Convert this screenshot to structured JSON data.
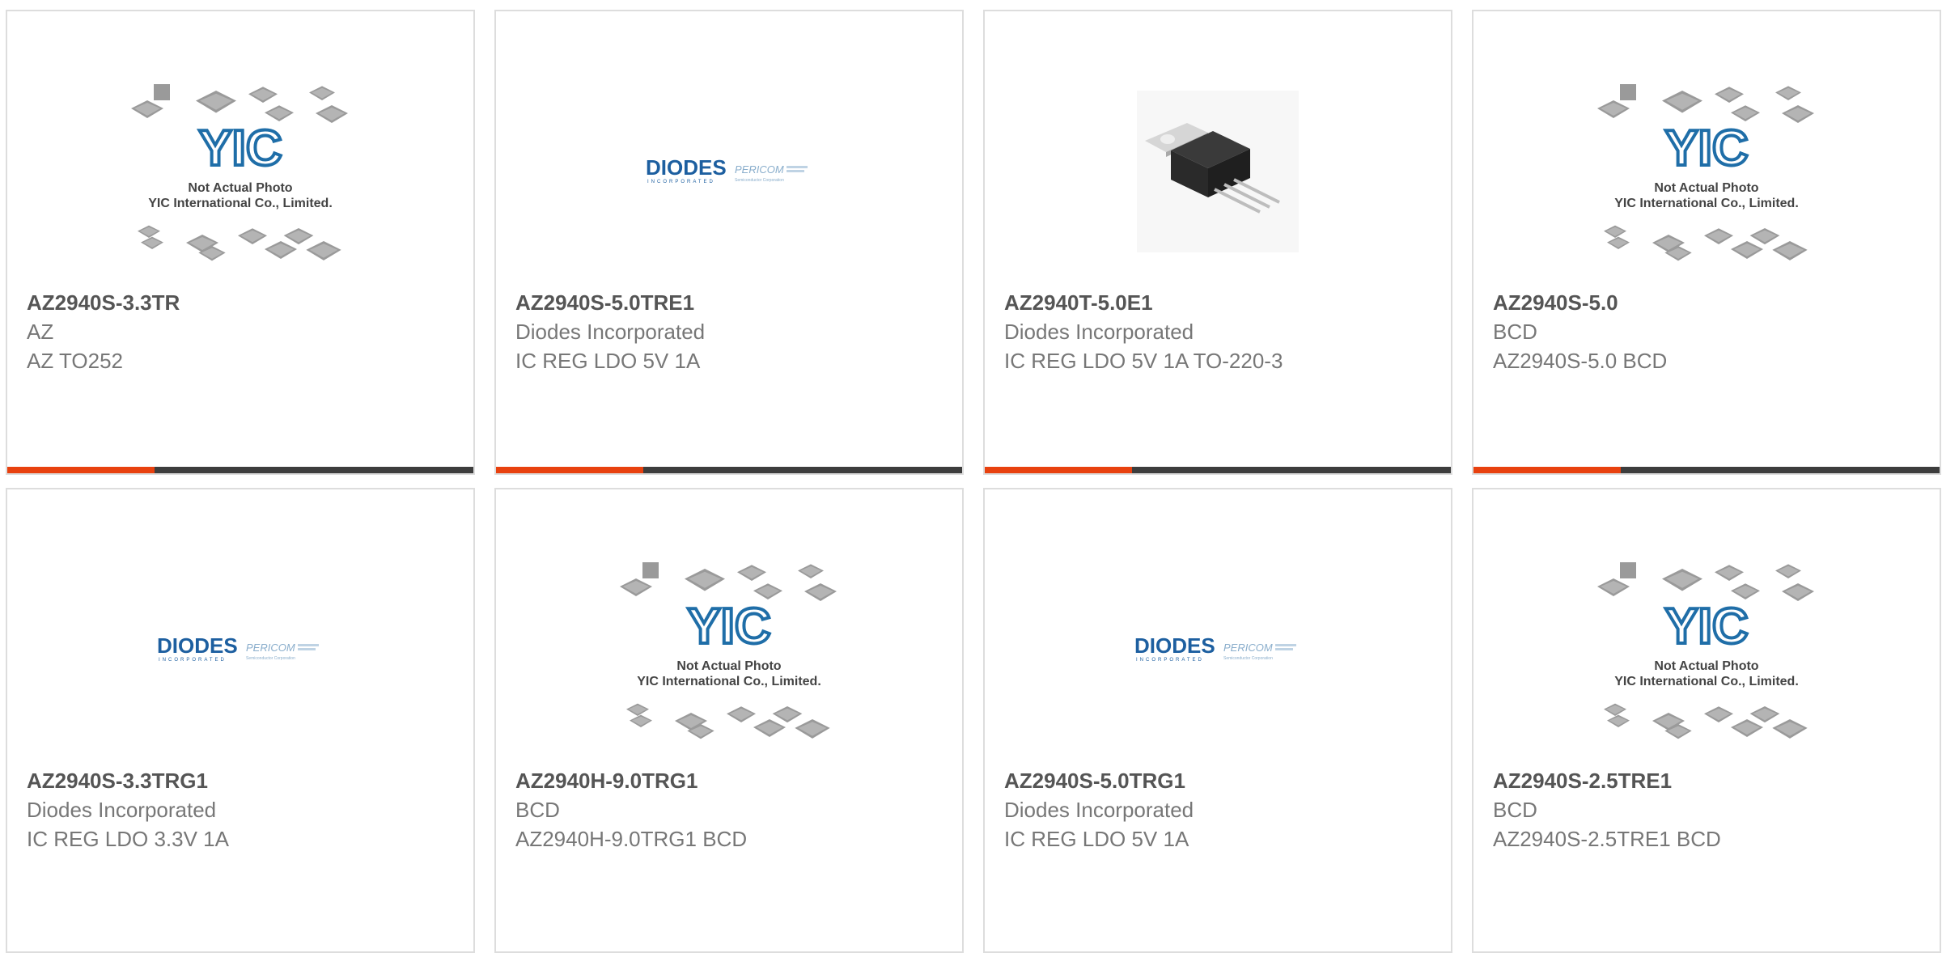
{
  "colors": {
    "accent_bar": "#e8410f",
    "dark_bar": "#3d3d3d",
    "border": "#dddddd",
    "yic_blue": "#1f6ea8",
    "diodes_blue": "#1d5fa0"
  },
  "placeholder_logo": {
    "brand": "YIC",
    "line1": "Not Actual Photo",
    "line2": "YIC International Co., Limited."
  },
  "diodes_logo": {
    "brand": "DIODES",
    "tagline": "INCORPORATED",
    "partner": "PERICOM",
    "partner_tagline": "Semiconductor Corporation"
  },
  "products": [
    {
      "part": "AZ2940S-3.3TR",
      "manufacturer": "AZ",
      "description": "AZ TO252",
      "image": "not-actual-photo"
    },
    {
      "part": "AZ2940S-5.0TRE1",
      "manufacturer": "Diodes Incorporated",
      "description": "IC REG LDO 5V 1A",
      "image": "diodes-logo"
    },
    {
      "part": "AZ2940T-5.0E1",
      "manufacturer": "Diodes Incorporated",
      "description": "IC REG LDO 5V 1A TO-220-3",
      "image": "to220-package"
    },
    {
      "part": "AZ2940S-5.0",
      "manufacturer": "BCD",
      "description": "AZ2940S-5.0 BCD",
      "image": "not-actual-photo"
    },
    {
      "part": "AZ2940S-3.3TRG1",
      "manufacturer": "Diodes Incorporated",
      "description": "IC REG LDO 3.3V 1A",
      "image": "diodes-logo"
    },
    {
      "part": "AZ2940H-9.0TRG1",
      "manufacturer": "BCD",
      "description": "AZ2940H-9.0TRG1 BCD",
      "image": "not-actual-photo"
    },
    {
      "part": "AZ2940S-5.0TRG1",
      "manufacturer": "Diodes Incorporated",
      "description": "IC REG LDO 5V 1A",
      "image": "diodes-logo"
    },
    {
      "part": "AZ2940S-2.5TRE1",
      "manufacturer": "BCD",
      "description": "AZ2940S-2.5TRE1 BCD",
      "image": "not-actual-photo"
    }
  ]
}
